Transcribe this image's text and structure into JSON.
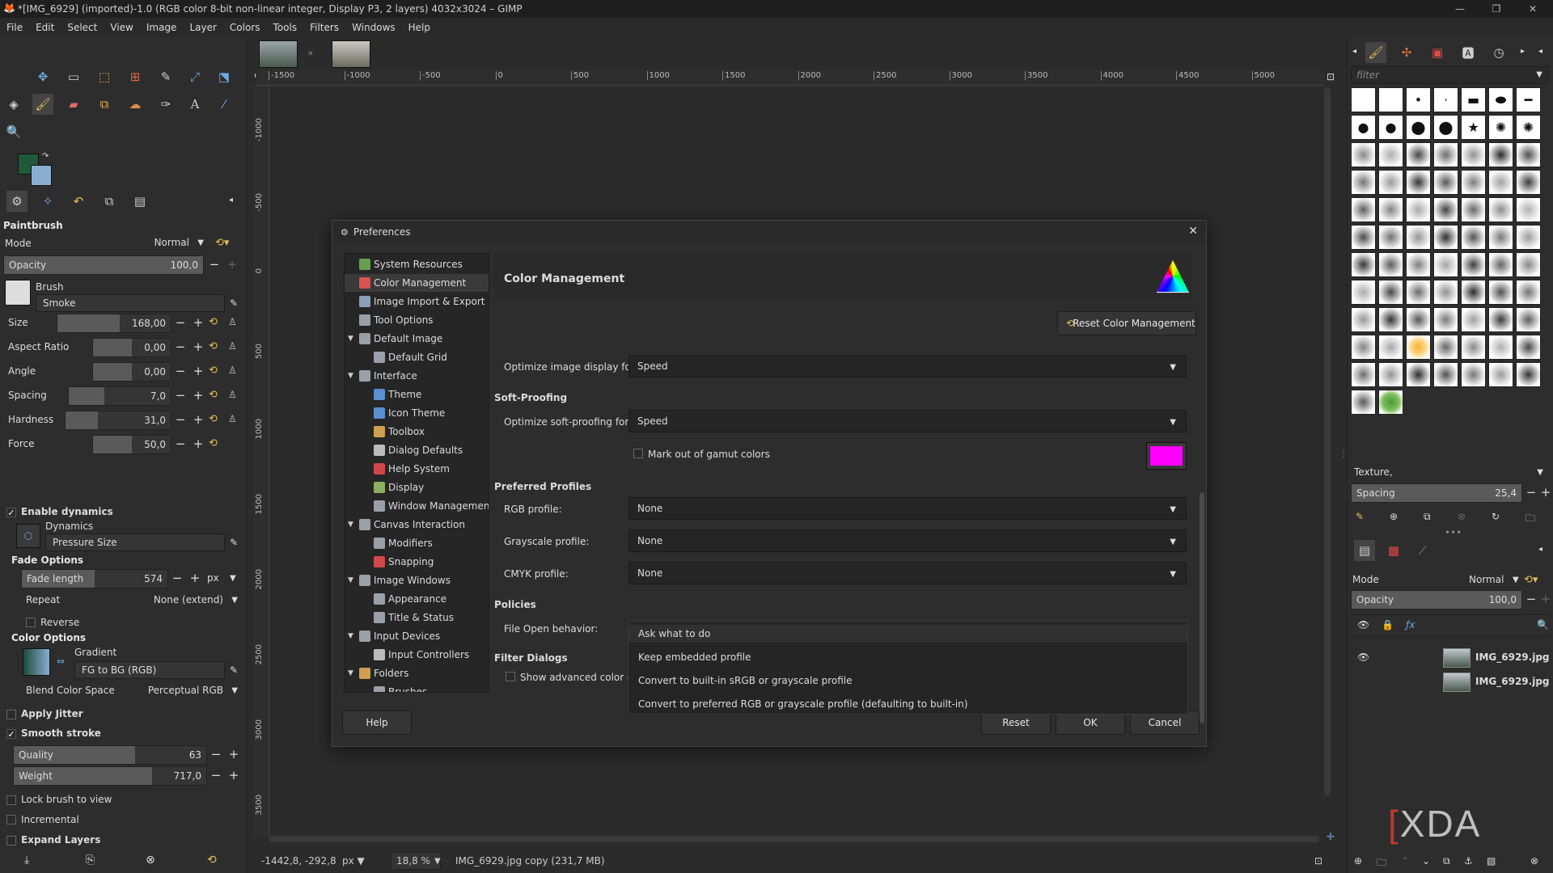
{
  "window": {
    "title": "*[IMG_6929] (imported)-1.0 (RGB color 8-bit non-linear integer, Display P3, 2 layers) 4032x3024 – GIMP"
  },
  "menu": [
    "File",
    "Edit",
    "Select",
    "View",
    "Image",
    "Layer",
    "Colors",
    "Tools",
    "Filters",
    "Windows",
    "Help"
  ],
  "tool_options": {
    "title": "Paintbrush",
    "mode_label": "Mode",
    "mode_value": "Normal",
    "opacity_label": "Opacity",
    "opacity_value": "100,0",
    "brush_label": "Brush",
    "brush_name": "Smoke",
    "sliders": [
      {
        "label": "Size",
        "value": "168,00",
        "fraction": 0.55
      },
      {
        "label": "Aspect Ratio",
        "value": "0,00",
        "fraction": 0.5
      },
      {
        "label": "Angle",
        "value": "0,00",
        "fraction": 0.5
      },
      {
        "label": "Spacing",
        "value": "7,0",
        "fraction": 0.35
      },
      {
        "label": "Hardness",
        "value": "31,0",
        "fraction": 0.31
      },
      {
        "label": "Force",
        "value": "50,0",
        "fraction": 0.5
      }
    ],
    "enable_dynamics": "Enable dynamics",
    "dynamics_label": "Dynamics",
    "dynamics_value": "Pressure Size",
    "fade_options": "Fade Options",
    "fade_length_label": "Fade length",
    "fade_length_value": "574",
    "fade_unit": "px",
    "repeat_label": "Repeat",
    "repeat_value": "None (extend)",
    "reverse": "Reverse",
    "color_options": "Color Options",
    "gradient_label": "Gradient",
    "gradient_value": "FG to BG (RGB)",
    "blend_label": "Blend Color Space",
    "blend_value": "Perceptual RGB",
    "apply_jitter": "Apply Jitter",
    "smooth_stroke": "Smooth stroke",
    "quality_label": "Quality",
    "quality_value": "63",
    "weight_label": "Weight",
    "weight_value": "717,0",
    "lock_brush": "Lock brush to view",
    "incremental": "Incremental",
    "expand_layers": "Expand Layers"
  },
  "ruler": {
    "h_ticks": [
      "-1500",
      "-1000",
      "-500",
      "0",
      "500",
      "1000",
      "1500",
      "2000",
      "2500",
      "3000",
      "3500",
      "4000",
      "4500",
      "5000"
    ],
    "v_ticks": [
      "-1000",
      "-500",
      "0",
      "500",
      "1000",
      "1500",
      "2000",
      "2500",
      "3000",
      "3500"
    ]
  },
  "status": {
    "coords": "-1442,8, -292,8",
    "unit": "px",
    "zoom": "18,8 %",
    "info": "IMG_6929.jpg copy (231,7 MB)"
  },
  "right_dock": {
    "filter_placeholder": "filter",
    "texture": "Texture,",
    "spacing_label": "Spacing",
    "spacing_value": "25,4",
    "mode_label": "Mode",
    "mode_value": "Normal",
    "opacity_label": "Opacity",
    "opacity_value": "100,0",
    "layers": [
      "IMG_6929.jpg copy",
      "IMG_6929.jpg"
    ]
  },
  "watermark": "XDA",
  "dialog": {
    "title": "Preferences",
    "tree": [
      {
        "label": "System Resources",
        "level": 0,
        "color": "#6a9e4f"
      },
      {
        "label": "Color Management",
        "level": 0,
        "color": "#d9534f",
        "selected": true
      },
      {
        "label": "Image Import & Export",
        "level": 0,
        "color": "#8aa0b8"
      },
      {
        "label": "Tool Options",
        "level": 0,
        "color": "#9aa0a8"
      },
      {
        "label": "Default Image",
        "level": 0,
        "color": "#9aa0a8",
        "expander": true
      },
      {
        "label": "Default Grid",
        "level": 1,
        "color": "#9aa0a8"
      },
      {
        "label": "Interface",
        "level": 0,
        "color": "#9aa0a8",
        "expander": true
      },
      {
        "label": "Theme",
        "level": 1,
        "color": "#5b8fd0"
      },
      {
        "label": "Icon Theme",
        "level": 1,
        "color": "#5b8fd0"
      },
      {
        "label": "Toolbox",
        "level": 1,
        "color": "#d0a050"
      },
      {
        "label": "Dialog Defaults",
        "level": 1,
        "color": "#bbbbbb"
      },
      {
        "label": "Help System",
        "level": 1,
        "color": "#d04848"
      },
      {
        "label": "Display",
        "level": 1,
        "color": "#8ab060"
      },
      {
        "label": "Window Management",
        "level": 1,
        "color": "#9aa0a8"
      },
      {
        "label": "Canvas Interaction",
        "level": 0,
        "color": "#9aa0a8",
        "expander": true
      },
      {
        "label": "Modifiers",
        "level": 1,
        "color": "#9aa0a8"
      },
      {
        "label": "Snapping",
        "level": 1,
        "color": "#d04848"
      },
      {
        "label": "Image Windows",
        "level": 0,
        "color": "#9aa0a8",
        "expander": true
      },
      {
        "label": "Appearance",
        "level": 1,
        "color": "#9aa0a8"
      },
      {
        "label": "Title & Status",
        "level": 1,
        "color": "#9aa0a8"
      },
      {
        "label": "Input Devices",
        "level": 0,
        "color": "#9aa0a8",
        "expander": true
      },
      {
        "label": "Input Controllers",
        "level": 1,
        "color": "#bbbbbb"
      },
      {
        "label": "Folders",
        "level": 0,
        "color": "#d0a050",
        "expander": true
      },
      {
        "label": "Brushes",
        "level": 1,
        "color": "#9aa0a8"
      }
    ],
    "heading": "Color Management",
    "reset_cm": "Reset Color Management",
    "optimize_display_label": "Optimize image display for:",
    "optimize_display_value": "Speed",
    "soft_proofing": "Soft-Proofing",
    "optimize_soft_label": "Optimize soft-proofing for:",
    "optimize_soft_value": "Speed",
    "mark_gamut": "Mark out of gamut colors",
    "gamut_color": "#ff00ff",
    "preferred_profiles": "Preferred Profiles",
    "rgb_label": "RGB profile:",
    "rgb_value": "None",
    "gray_label": "Grayscale profile:",
    "gray_value": "None",
    "cmyk_label": "CMYK profile:",
    "cmyk_value": "None",
    "policies": "Policies",
    "file_open_label": "File Open behavior:",
    "filter_dialogs": "Filter Dialogs",
    "show_advanced": "Show advanced color o",
    "popup_options": [
      "Ask what to do",
      "Keep embedded profile",
      "Convert to built-in sRGB or grayscale profile",
      "Convert to preferred RGB or grayscale profile (defaulting to built-in)"
    ],
    "buttons": {
      "help": "Help",
      "reset": "Reset",
      "ok": "OK",
      "cancel": "Cancel"
    }
  }
}
